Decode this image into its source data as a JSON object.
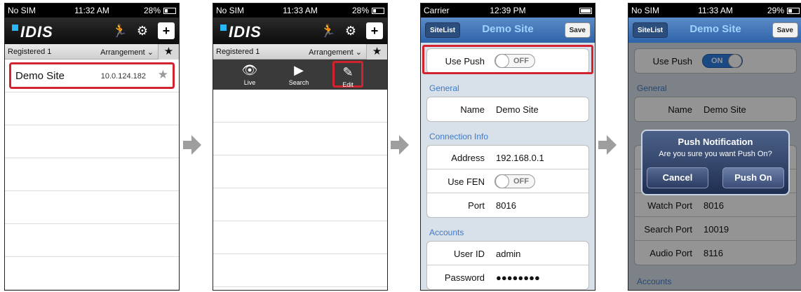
{
  "screens": {
    "list": {
      "carrier": "No SIM",
      "time": "11:32 AM",
      "battery": "28%",
      "battery_level": 0.28,
      "logo": "IDIS",
      "icons": [
        "run-icon",
        "gear-icon",
        "plus-icon"
      ],
      "registered": "Registered 1",
      "arrangement": "Arrangement",
      "site_name": "Demo Site",
      "site_ip": "10.0.124.182"
    },
    "actions": {
      "carrier": "No SIM",
      "time": "11:33 AM",
      "battery": "28%",
      "registered": "Registered 1",
      "arrangement": "Arrangement",
      "live_label": "Live",
      "search_label": "Search",
      "edit_label": "Edit"
    },
    "edit": {
      "carrier": "Carrier",
      "time": "12:39 PM",
      "back_label": "SiteList",
      "title": "Demo Site",
      "save_label": "Save",
      "use_push_label": "Use Push",
      "use_push_state": "OFF",
      "general_header": "General",
      "name_label": "Name",
      "name_value": "Demo Site",
      "connection_header": "Connection Info",
      "address_label": "Address",
      "address_value": "192.168.0.1",
      "use_fen_label": "Use FEN",
      "use_fen_state": "OFF",
      "port_label": "Port",
      "port_value": "8016",
      "accounts_header": "Accounts",
      "user_label": "User ID",
      "user_value": "admin",
      "password_label": "Password",
      "password_value": "●●●●●●●●"
    },
    "confirm": {
      "carrier": "No SIM",
      "time": "11:33 AM",
      "battery": "29%",
      "back_label": "SiteList",
      "title": "Demo Site",
      "save_label": "Save",
      "use_push_label": "Use Push",
      "use_push_state": "ON",
      "general_header": "General",
      "name_label": "Name",
      "name_value": "Demo Site",
      "watch_port_label": "Watch Port",
      "watch_port_value": "8016",
      "search_port_label": "Search Port",
      "search_port_value": "10019",
      "audio_port_label": "Audio Port",
      "audio_port_value": "8116",
      "accounts_header": "Accounts",
      "alert_title": "Push Notification",
      "alert_message": "Are you sure you want Push On?",
      "cancel_label": "Cancel",
      "confirm_label": "Push On"
    }
  },
  "colors": {
    "highlight": "#d3232e",
    "accent": "#2e7fe3",
    "section": "#3e7bc4"
  }
}
